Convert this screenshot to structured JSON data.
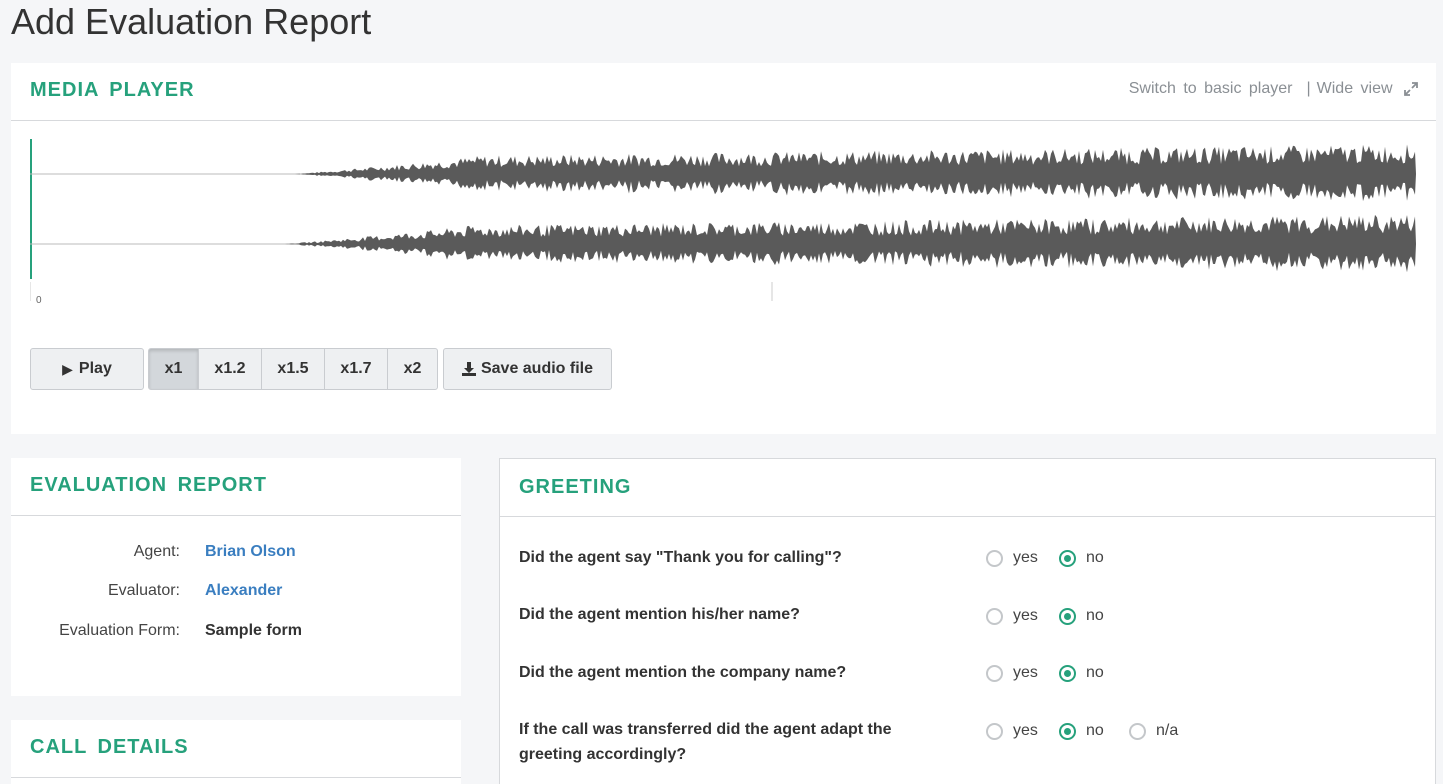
{
  "page": {
    "title": "Add Evaluation Report"
  },
  "media_player": {
    "title": "MEDIA PLAYER",
    "switch_link": "Switch to basic player",
    "separator": "|",
    "wide_view_link": "Wide view",
    "timeline_start": "0",
    "play_label": "Play",
    "speeds": [
      "x1",
      "x1.2",
      "x1.5",
      "x1.7",
      "x2"
    ],
    "active_speed": "x1",
    "save_label": "Save audio file",
    "accent_color": "#26a17c"
  },
  "evaluation_report": {
    "title": "EVALUATION REPORT",
    "agent_label": "Agent:",
    "agent_value": "Brian Olson",
    "evaluator_label": "Evaluator:",
    "evaluator_value": "Alexander",
    "form_label": "Evaluation Form:",
    "form_value": "Sample form"
  },
  "call_details": {
    "title": "CALL DETAILS"
  },
  "greeting": {
    "title": "GREETING",
    "questions": [
      {
        "text": "Did the agent say \"Thank you for calling\"?",
        "yes": "yes",
        "no": "no",
        "selected": "no"
      },
      {
        "text": "Did the agent mention his/her name?",
        "yes": "yes",
        "no": "no",
        "selected": "no"
      },
      {
        "text": "Did the agent mention the company name?",
        "yes": "yes",
        "no": "no",
        "selected": "no"
      },
      {
        "text_line1": "If the call was transferred did the agent adapt the",
        "text_line2": "greeting accordingly?",
        "yes": "yes",
        "no": "no",
        "na": "n/a",
        "selected": "no"
      }
    ]
  }
}
